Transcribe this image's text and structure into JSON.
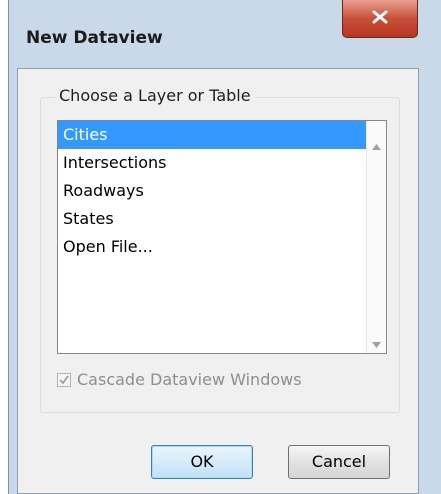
{
  "window": {
    "title": "New Dataview"
  },
  "group": {
    "legend": "Choose a Layer or Table"
  },
  "list": {
    "items": [
      {
        "label": "Cities",
        "selected": true
      },
      {
        "label": "Intersections",
        "selected": false
      },
      {
        "label": "Roadways",
        "selected": false
      },
      {
        "label": "States",
        "selected": false
      },
      {
        "label": "Open File...",
        "selected": false
      }
    ]
  },
  "cascade": {
    "label": "Cascade Dataview Windows",
    "checked": true,
    "enabled": false
  },
  "buttons": {
    "ok_label": "OK",
    "cancel_label": "Cancel"
  },
  "colors": {
    "selection": "#3399ff",
    "close_button": "#c7503a",
    "frame": "#c9d9ea"
  }
}
